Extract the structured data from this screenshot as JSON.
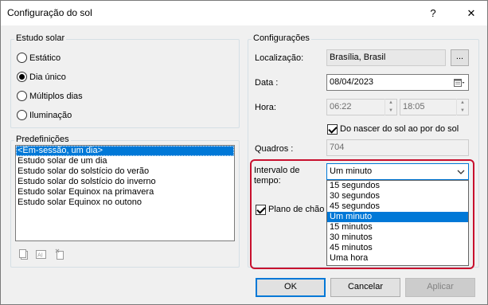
{
  "window": {
    "title": "Configuração do sol",
    "help_label": "?",
    "close_label": "✕"
  },
  "estudo_solar": {
    "title": "Estudo solar",
    "options": [
      {
        "label": "Estático",
        "checked": false
      },
      {
        "label": "Dia único",
        "checked": true
      },
      {
        "label": "Múltiplos dias",
        "checked": false
      },
      {
        "label": "Iluminação",
        "checked": false
      }
    ]
  },
  "predefinicoes": {
    "title": "Predefinições",
    "items": [
      "<Em-sessão, um dia>",
      "Estudo solar de um dia",
      "Estudo solar do solstício do verão",
      "Estudo solar do solstício do inverno",
      "Estudo solar Equinox na primavera",
      "Estudo solar Equinox no outono"
    ],
    "selected_index": 0,
    "icons": [
      "duplicate-icon",
      "rename-icon",
      "delete-icon"
    ]
  },
  "configuracoes": {
    "title": "Configurações",
    "localizacao_label": "Localização:",
    "localizacao_value": "Brasília, Brasil",
    "browse_label": "...",
    "data_label": "Data :",
    "data_value": "08/04/2023",
    "hora_label": "Hora:",
    "hora_start": "06:22",
    "hora_end": "18:05",
    "sunrise_checkbox_label": "Do nascer do sol ao por do sol",
    "sunrise_checked": true,
    "quadros_label": "Quadros :",
    "quadros_value": "704",
    "intervalo_label_line1": "Intervalo de",
    "intervalo_label_line2": "tempo:",
    "intervalo_value": "Um minuto",
    "intervalo_options": [
      "15 segundos",
      "30 segundos",
      "45 segundos",
      "Um minuto",
      "15 minutos",
      "30 minutos",
      "45 minutos",
      "Uma hora"
    ],
    "intervalo_selected_index": 3,
    "plano_label": "Plano de chão",
    "plano_checked": true
  },
  "footer": {
    "ok_label": "OK",
    "cancel_label": "Cancelar",
    "apply_label": "Aplicar"
  },
  "colors": {
    "selection": "#0078d7",
    "highlight": "#c8102e"
  }
}
